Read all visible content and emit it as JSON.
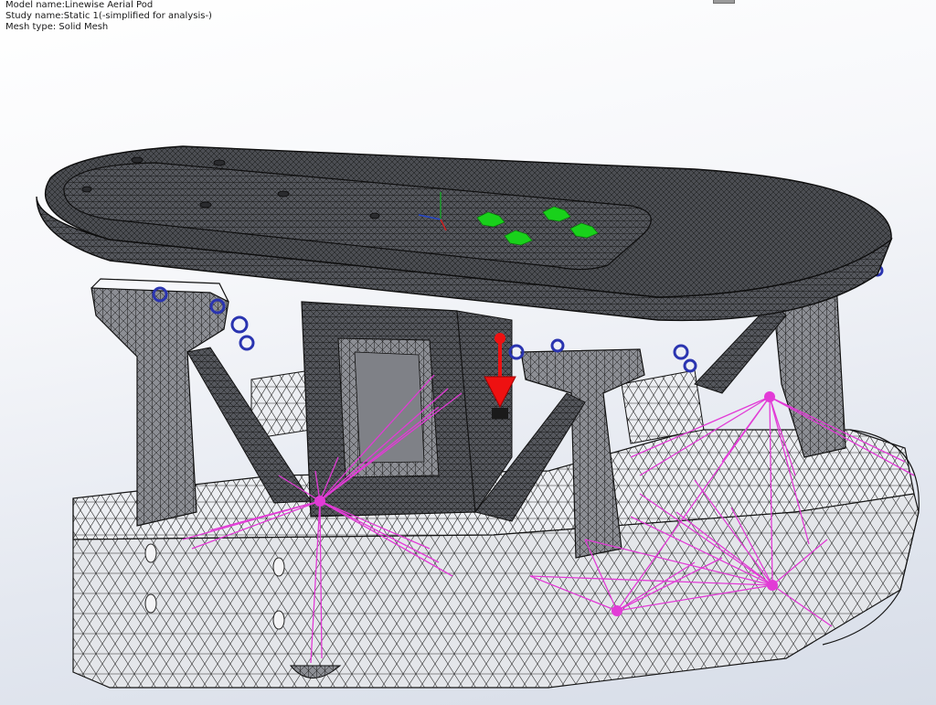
{
  "info": {
    "model_name": "Model name:Linewise Aerial Pod",
    "study_name": "Study name:Static 1(-simplified for analysis-)",
    "mesh_type": "Mesh type: Solid Mesh"
  },
  "colors": {
    "background_top": "#ffffff",
    "background_bottom": "#d7dde8",
    "mesh_dark": "#4a4c52",
    "mesh_light": "#e9eaee",
    "mesh_line": "#1b1b1b",
    "fixture_green": "#19d11b",
    "load_arrow_red": "#ee1111",
    "connector_magenta": "#e23bd6",
    "bolt_blue": "#2a34b0"
  },
  "icons": {
    "triad": "axis-triad-icon",
    "load": "down-arrow-icon",
    "fixture": "fixture-marker-icon"
  }
}
